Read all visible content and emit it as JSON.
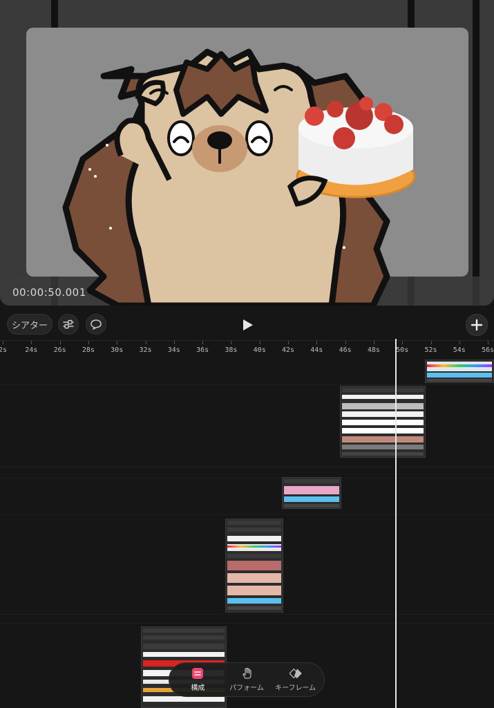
{
  "preview": {
    "timecode": "00:00:50.001"
  },
  "toolbar": {
    "theater_label": "シアター",
    "adjust_icon": "sliders-icon",
    "comment_icon": "speech-bubble-icon",
    "play_icon": "play-icon",
    "add_icon": "plus-icon"
  },
  "ruler": {
    "labels": [
      "2s",
      "24s",
      "26s",
      "28s",
      "30s",
      "32s",
      "34s",
      "36s",
      "38s",
      "40s",
      "42s",
      "44s",
      "46s",
      "48s",
      "50s",
      "52s",
      "54s",
      "56s"
    ]
  },
  "bottom_nav": {
    "items": [
      {
        "label": "構成",
        "icon": "composition-icon",
        "active": true
      },
      {
        "label": "パフォーム",
        "icon": "hand-icon",
        "active": false
      },
      {
        "label": "キーフレーム",
        "icon": "keyframe-icon",
        "active": false
      }
    ]
  },
  "colors": {
    "accent": "#e8476b",
    "clip_blue": "#5bc0ee",
    "playhead": "#e8e8e8",
    "background": "#161616"
  }
}
